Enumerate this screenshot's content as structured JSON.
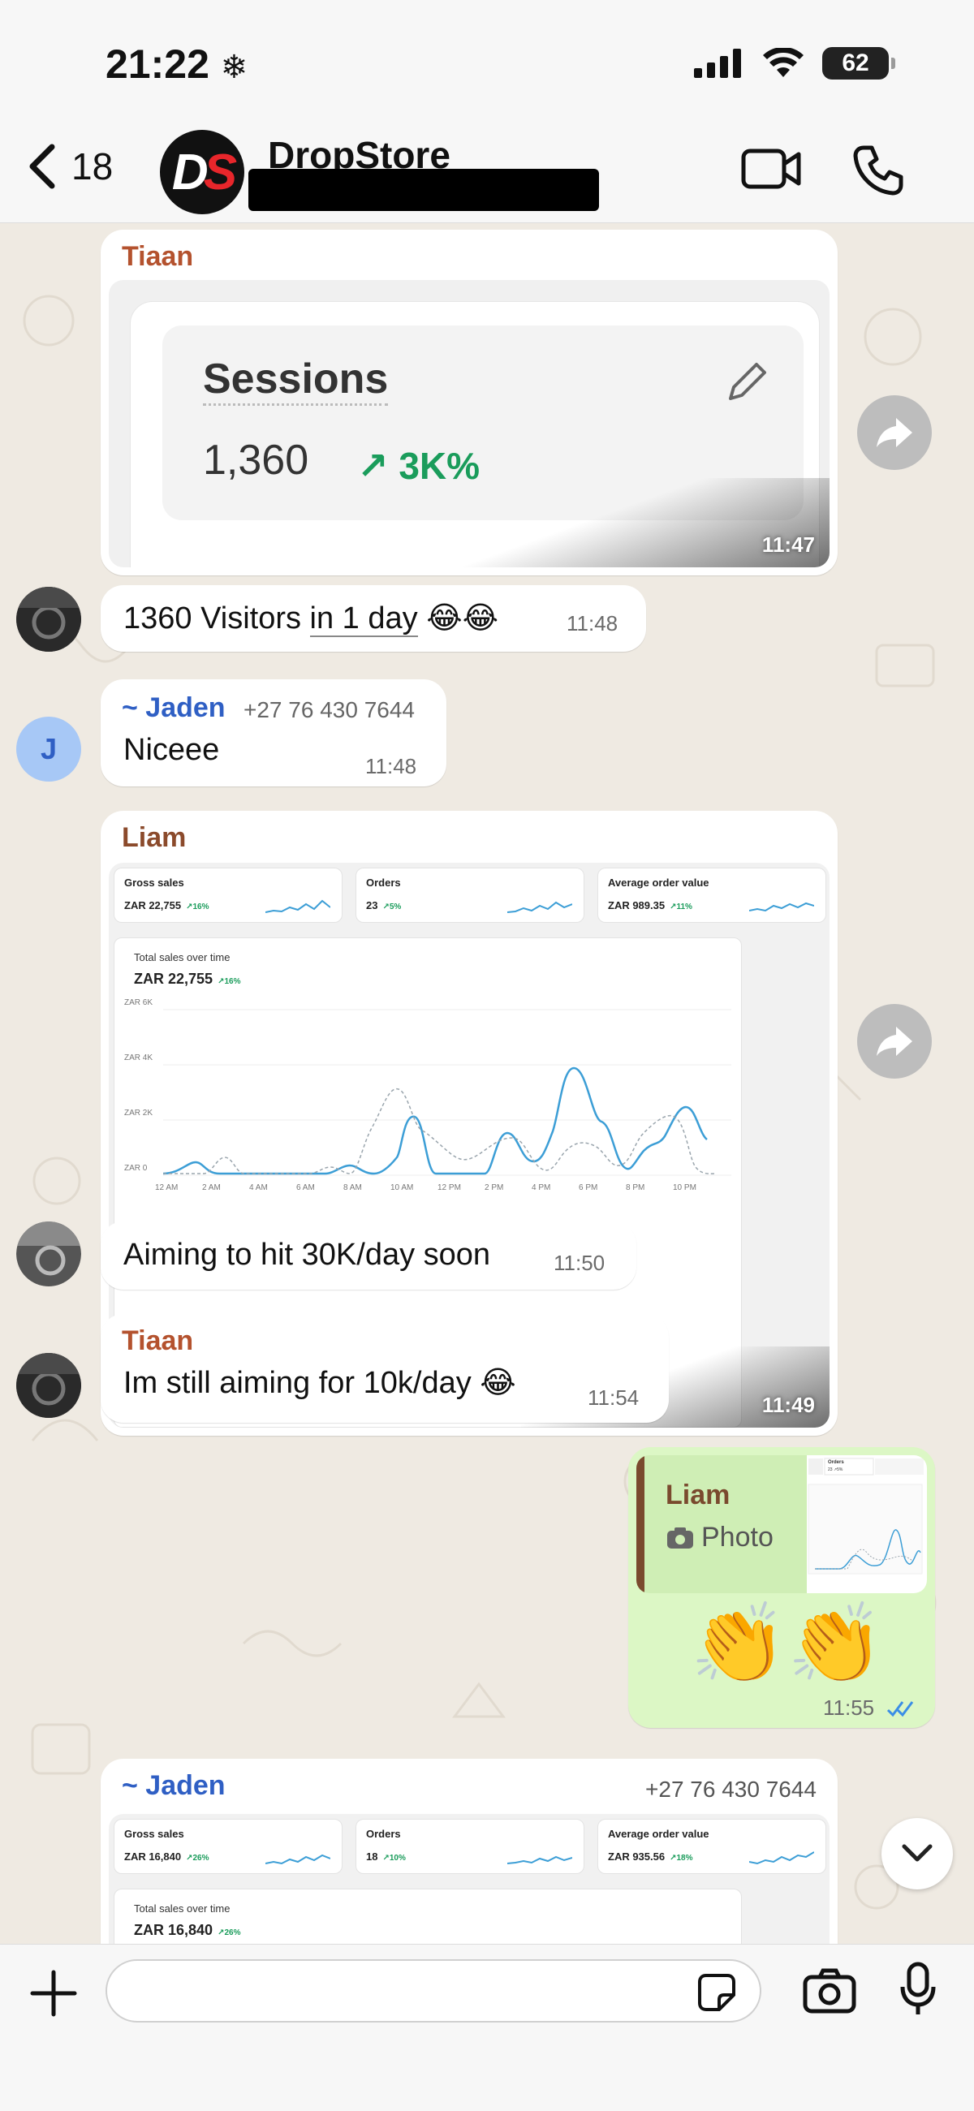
{
  "status_bar": {
    "time": "21:22",
    "battery": "62"
  },
  "header": {
    "back_count": "18",
    "avatar_text_d": "D",
    "avatar_text_s": "S",
    "chat_title": "DropStore"
  },
  "messages": [
    {
      "sender": "Tiaan",
      "sender_color": "#b4522e",
      "image": {
        "card_title": "Sessions",
        "card_value": "1,360",
        "card_delta": "3K%"
      },
      "time": "11:47"
    },
    {
      "text_before": "1360 Visitors ",
      "text_underlined": "in 1 day",
      "text_emoji": " 😂😂",
      "time": "11:48"
    },
    {
      "sender": "~ Jaden",
      "sender_color": "#2f5fc4",
      "phone": "+27 76 430 7644",
      "avatar_letter": "J",
      "text": "Niceee",
      "time": "11:48"
    },
    {
      "sender": "Liam",
      "sender_color": "#8b4a2b",
      "image": {
        "kpis": [
          {
            "title": "Gross sales",
            "value": "ZAR 22,755",
            "delta": "↗16%"
          },
          {
            "title": "Orders",
            "value": "23",
            "delta": "↗5%"
          },
          {
            "title": "Average order value",
            "value": "ZAR 989.35",
            "delta": "↗11%"
          }
        ],
        "chart_title": "Total sales over time",
        "chart_value": "ZAR 22,755",
        "chart_delta": "↗16%",
        "y_ticks": [
          "ZAR 6K",
          "ZAR 4K",
          "ZAR 2K",
          "ZAR 0"
        ],
        "x_ticks": [
          "12 AM",
          "2 AM",
          "4 AM",
          "6 AM",
          "8 AM",
          "10 AM",
          "12 PM",
          "2 PM",
          "4 PM",
          "6 PM",
          "8 PM",
          "10 PM"
        ]
      },
      "time": "11:49"
    },
    {
      "text": "Aiming to hit 30K/day soon",
      "time": "11:50"
    },
    {
      "sender": "Tiaan",
      "sender_color": "#b4522e",
      "text": "Im still aiming for 10k/day 😂",
      "time": "11:54"
    },
    {
      "outgoing": true,
      "quote_sender": "Liam",
      "quote_type": "Photo",
      "quote_thumb": {
        "kpi_title": "Orders",
        "kpi_value": "23 ↗5%"
      },
      "text": "👏👏",
      "time": "11:55"
    },
    {
      "sender": "~ Jaden",
      "sender_color": "#2f5fc4",
      "phone": "+27 76 430 7644",
      "image": {
        "kpis": [
          {
            "title": "Gross sales",
            "value": "ZAR 16,840",
            "delta": "↗26%"
          },
          {
            "title": "Orders",
            "value": "18",
            "delta": "↗10%"
          },
          {
            "title": "Average order value",
            "value": "ZAR 935.56",
            "delta": "↗18%"
          }
        ],
        "chart_title": "Total sales over time",
        "chart_value": "ZAR 16,840",
        "chart_delta": "↗26%"
      }
    }
  ],
  "colors": {
    "outgoing_bubble": "#dcf7c5",
    "chart_line": "#3c9ed6",
    "chart_compare": "#9aa5ad",
    "tick_blue": "#3b8ee6"
  },
  "icons": [
    "chevron-left-icon",
    "video-camera-icon",
    "phone-icon",
    "forward-icon",
    "plus-icon",
    "sticker-icon",
    "camera-icon",
    "microphone-icon",
    "chevron-down-icon",
    "read-receipt-icon"
  ]
}
